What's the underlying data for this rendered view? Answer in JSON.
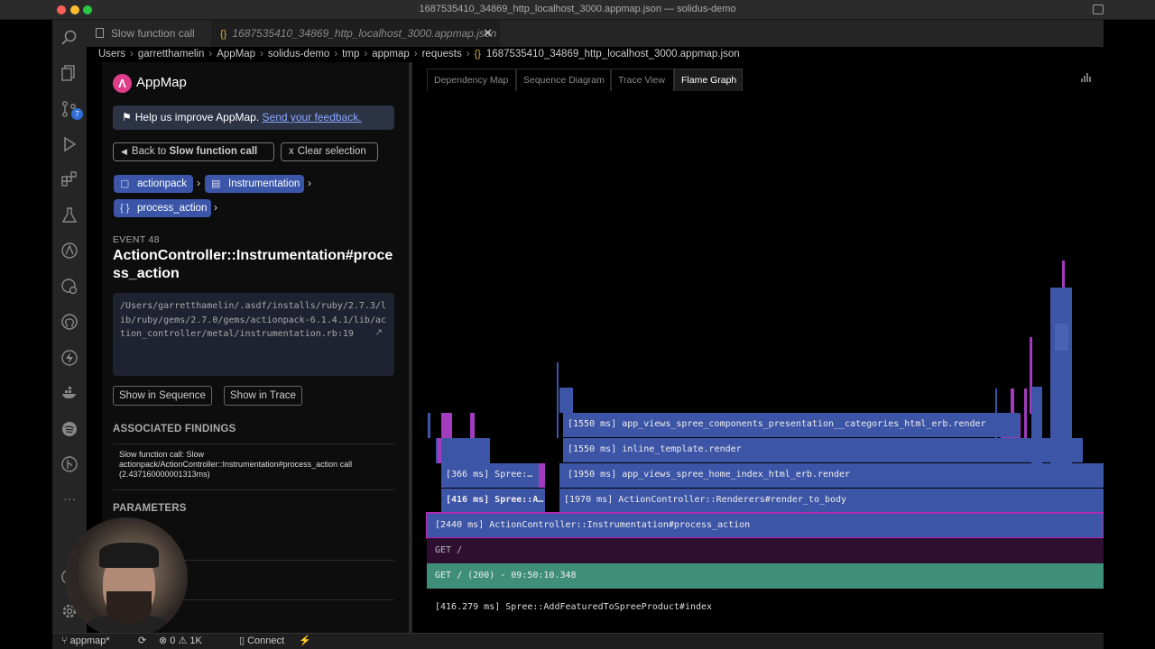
{
  "window": {
    "title": "1687535410_34869_http_localhost_3000.appmap.json — solidus-demo"
  },
  "activity_bar": {
    "items": [
      {
        "name": "explorer-icon"
      },
      {
        "name": "search-icon"
      },
      {
        "name": "source-control-icon"
      },
      {
        "name": "run-debug-icon"
      },
      {
        "name": "extensions-icon"
      },
      {
        "name": "testing-icon"
      },
      {
        "name": "appmap-icon"
      },
      {
        "name": "remote-icon"
      },
      {
        "name": "github-icon"
      },
      {
        "name": "bolt-icon"
      },
      {
        "name": "docker-icon"
      },
      {
        "name": "spotify-icon"
      },
      {
        "name": "git-graph-icon"
      },
      {
        "name": "more-icon"
      }
    ],
    "source_control_badge": "7"
  },
  "tabs": [
    {
      "label": "Slow function call",
      "active": false
    },
    {
      "label": "1687535410_34869_http_localhost_3000.appmap.json",
      "active": true
    }
  ],
  "breadcrumb": [
    "Users",
    "garretthamelin",
    "AppMap",
    "solidus-demo",
    "tmp",
    "appmap",
    "requests",
    "1687535410_34869_http_localhost_3000.appmap.json"
  ],
  "sidebar": {
    "app_title": "AppMap",
    "feedback_text": "Help us improve AppMap.",
    "feedback_link": "Send your feedback.",
    "back_prefix": "Back to",
    "back_target": "Slow function call",
    "clear_selection": "Clear selection",
    "clear_x": "x",
    "chips": [
      "actionpack",
      "Instrumentation",
      "process_action"
    ],
    "event_label": "EVENT 48",
    "event_name": "ActionController::Instrumentation#process_action",
    "path": "/Users/garretthamelin/.asdf/installs/ruby/2.7.3/lib/ruby/gems/2.7.0/gems/actionpack-6.1.4.1/lib/action_controller/metal/instrumentation.rb:19",
    "show_in_sequence": "Show in Sequence",
    "show_in_trace": "Show in Trace",
    "associated_findings_title": "ASSOCIATED FINDINGS",
    "finding_text": "Slow function call: Slow actionpack/ActionController::Instrumentation#process_action call (2.437160000001313ms)",
    "parameters_title": "PARAMETERS"
  },
  "views": {
    "tabs": [
      "Dependency Map",
      "Sequence Diagram",
      "Trace View",
      "Flame Graph"
    ],
    "active": "Flame Graph"
  },
  "flame_graph": {
    "frames": [
      {
        "label": "[1550 ms] app_views_spree_components_presentation__categories_html_erb.render"
      },
      {
        "label": "[1550 ms] inline_template.render"
      },
      {
        "label": "[366 ms] Spree:…"
      },
      {
        "label": "[1950 ms] app_views_spree_home_index_html_erb.render"
      },
      {
        "label": "[416 ms] Spree::A…"
      },
      {
        "label": "[1970 ms] ActionController::Renderers#render_to_body"
      },
      {
        "label": "[2440 ms] ActionController::Instrumentation#process_action"
      },
      {
        "label": "GET /"
      },
      {
        "label": "GET / (200) - 09:50:10.348"
      }
    ],
    "hover_detail": "[416.279 ms] Spree::AddFeaturedToSpreeProduct#index",
    "colors": {
      "frame": "#3d55a6",
      "selected_border": "#b02ab8",
      "request": "#2e0f32",
      "root": "#3f8f78",
      "spike": "#a23bbd"
    }
  },
  "status_bar": {
    "branch": "appmap*",
    "errors": "0",
    "warnings": "1K",
    "connect": "Connect"
  }
}
